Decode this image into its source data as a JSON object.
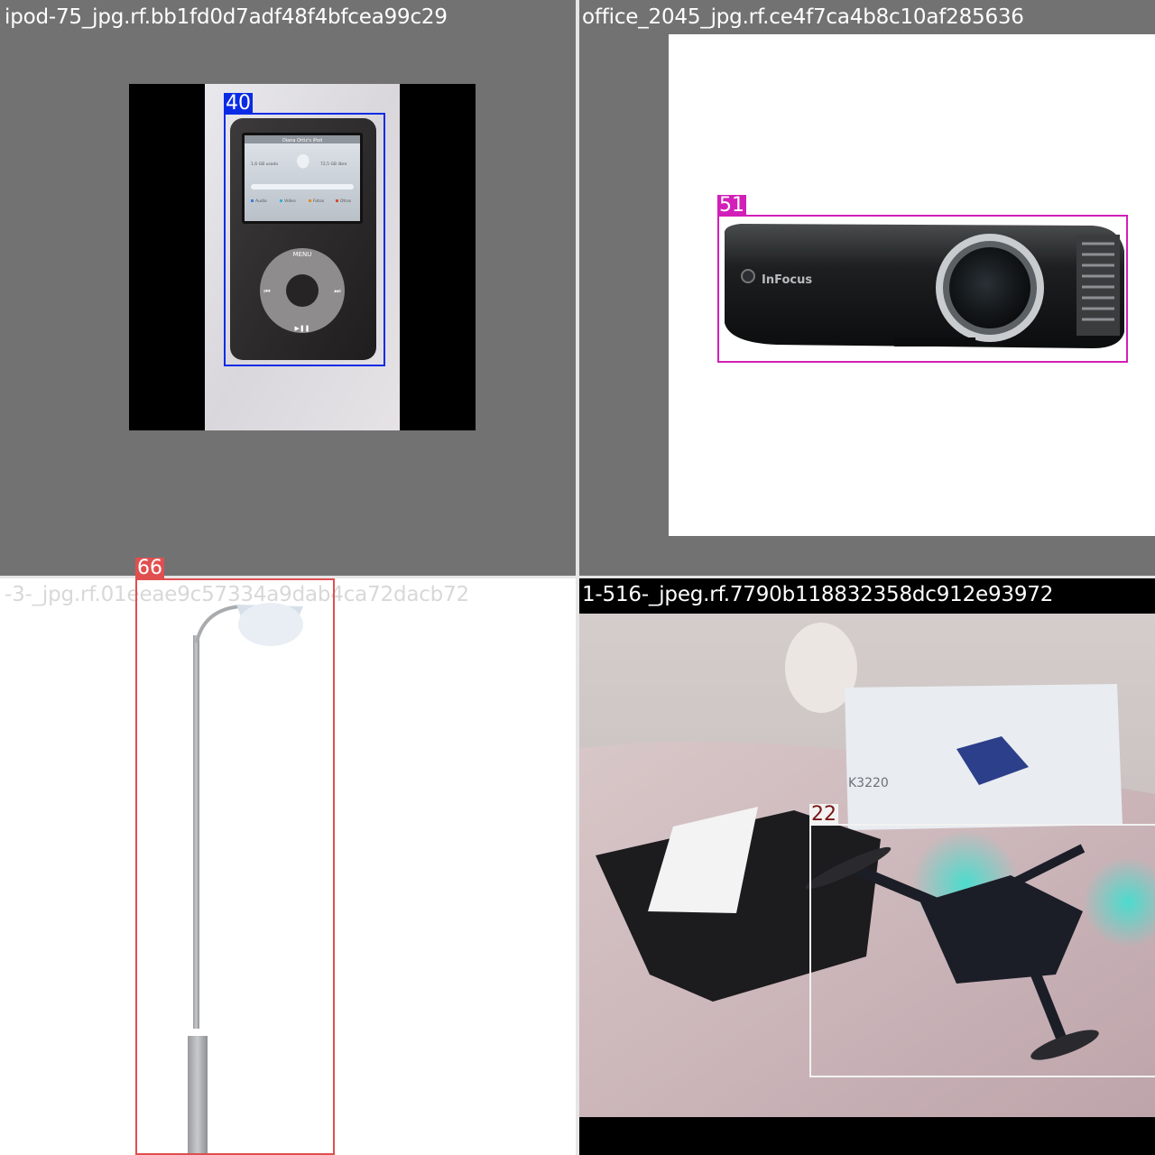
{
  "colors": {
    "grey_pad": "#727272",
    "ipod_box": "#0a2be6",
    "projector_box": "#d21fb8",
    "lamp_box": "#e04f50",
    "drone_box": "#f2f2f2",
    "drone_tag_text": "#7a1515"
  },
  "tiles": [
    {
      "filename": "ipod-75_jpg.rf.bb1fd0d7adf48f4bfcea99c29",
      "box_label": "40",
      "subject": "ipod-icon",
      "screen": {
        "owner": "Diana Ortiz's iPod",
        "used": "1,6 GB usado",
        "free": "72,5 GB libre",
        "legend": [
          "Audio",
          "Vídeo",
          "Fotos",
          "Otros"
        ]
      },
      "wheel": {
        "menu": "MENU",
        "prev": "⏮",
        "next": "⏭",
        "play": "▶❚❚"
      }
    },
    {
      "filename": "office_2045_jpg.rf.ce4f7ca4b8c10af285636",
      "box_label": "51",
      "subject": "projector-icon",
      "brand": "InFocus"
    },
    {
      "filename": "-3-_jpg.rf.01eeae9c57334a9dab4ca72dacb72",
      "box_label": "66",
      "subject": "street-lamp-icon"
    },
    {
      "filename": "1-516-_jpeg.rf.7790b118832358dc912e93972",
      "box_label": "22",
      "subject": "drone-icon",
      "box_print": "K3220"
    }
  ]
}
